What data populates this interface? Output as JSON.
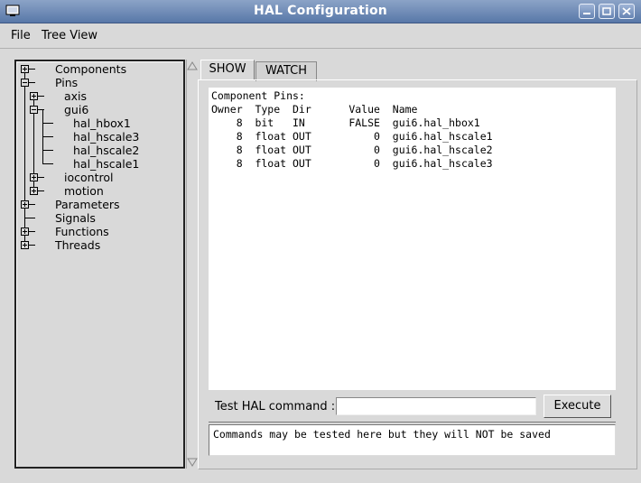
{
  "window": {
    "title": "HAL Configuration"
  },
  "menubar": {
    "file": "File",
    "tree_view": "Tree View"
  },
  "tree": {
    "components": "Components",
    "pins": "Pins",
    "axis": "axis",
    "gui6": "gui6",
    "hal_hbox1": "hal_hbox1",
    "hal_hscale3": "hal_hscale3",
    "hal_hscale2": "hal_hscale2",
    "hal_hscale1": "hal_hscale1",
    "iocontrol": "iocontrol",
    "motion": "motion",
    "parameters": "Parameters",
    "signals": "Signals",
    "functions": "Functions",
    "threads": "Threads"
  },
  "tabs": {
    "show": "SHOW",
    "watch": "WATCH"
  },
  "show": {
    "heading": "Component Pins:",
    "table": {
      "header": [
        "Owner",
        "Type",
        "Dir",
        "Value",
        "Name"
      ],
      "rows": [
        [
          "8",
          "bit",
          "IN",
          "FALSE",
          "gui6.hal_hbox1"
        ],
        [
          "8",
          "float",
          "OUT",
          "0",
          "gui6.hal_hscale1"
        ],
        [
          "8",
          "float",
          "OUT",
          "0",
          "gui6.hal_hscale2"
        ],
        [
          "8",
          "float",
          "OUT",
          "0",
          "gui6.hal_hscale3"
        ]
      ]
    }
  },
  "command": {
    "label": "Test HAL command :",
    "value": "",
    "execute": "Execute"
  },
  "output": {
    "text": "Commands may be tested here but they will NOT be saved"
  }
}
